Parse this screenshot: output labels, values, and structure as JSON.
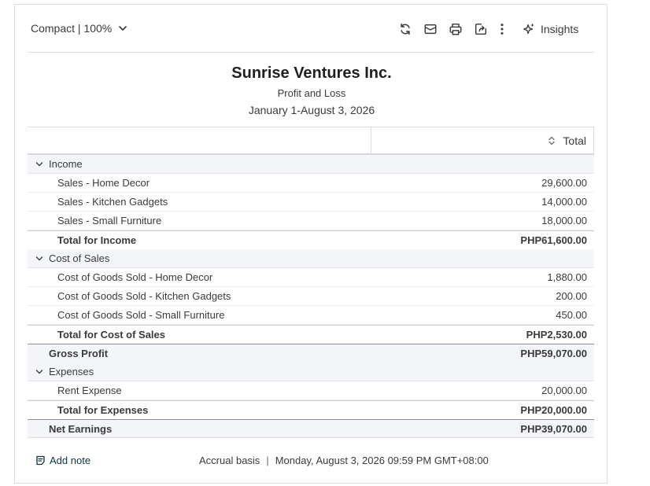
{
  "toolbar": {
    "view_label": "Compact | 100%",
    "icons": [
      "refresh-icon",
      "email-icon",
      "print-icon",
      "export-icon",
      "more-vertical-icon"
    ],
    "insights_label": "Insights"
  },
  "header": {
    "company": "Sunrise Ventures Inc.",
    "report_name": "Profit and Loss",
    "date_range": "January 1-August 3, 2026"
  },
  "table": {
    "column_header": "Total",
    "income": {
      "label": "Income",
      "rows": [
        {
          "label": "Sales - Home Decor",
          "amount": "29,600.00"
        },
        {
          "label": "Sales - Kitchen Gadgets",
          "amount": "14,000.00"
        },
        {
          "label": "Sales - Small Furniture",
          "amount": "18,000.00"
        }
      ],
      "total_label": "Total for Income",
      "total_amount": "PHP61,600.00"
    },
    "cost_of_sales": {
      "label": "Cost of Sales",
      "rows": [
        {
          "label": "Cost of Goods Sold - Home Decor",
          "amount": "1,880.00"
        },
        {
          "label": "Cost of Goods Sold - Kitchen Gadgets",
          "amount": "200.00"
        },
        {
          "label": "Cost of Goods Sold - Small Furniture",
          "amount": "450.00"
        }
      ],
      "total_label": "Total for Cost of Sales",
      "total_amount": "PHP2,530.00"
    },
    "gross_profit": {
      "label": "Gross Profit",
      "amount": "PHP59,070.00"
    },
    "expenses": {
      "label": "Expenses",
      "rows": [
        {
          "label": "Rent Expense",
          "amount": "20,000.00"
        }
      ],
      "total_label": "Total for Expenses",
      "total_amount": "PHP20,000.00"
    },
    "net_earnings": {
      "label": "Net Earnings",
      "amount": "PHP39,070.00"
    }
  },
  "footer": {
    "add_note_label": "Add note",
    "basis": "Accrual basis",
    "separator": "|",
    "timestamp": "Monday, August 3, 2026 09:59 PM GMT+08:00"
  },
  "colors": {
    "text": "#393a3d",
    "section_bg": "#f4f5f8",
    "note_link": "#0d333f"
  }
}
